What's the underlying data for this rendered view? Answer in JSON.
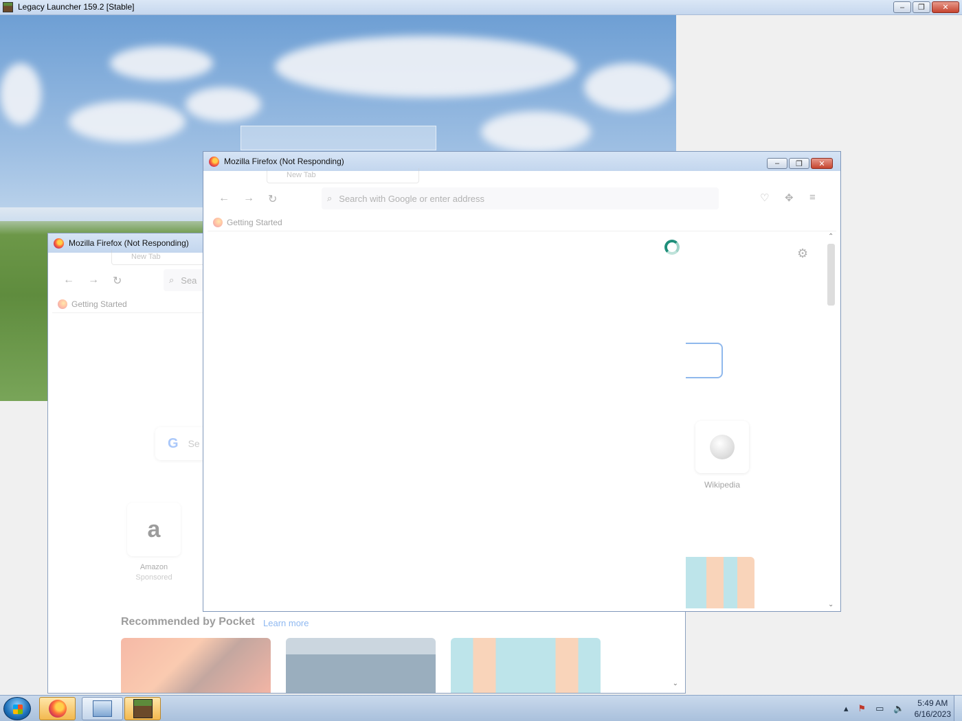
{
  "launcher": {
    "title": "Legacy Launcher 159.2 [Stable]",
    "buttons": {
      "minimize": "–",
      "restore": "❐",
      "close": "✕"
    }
  },
  "firefox_back": {
    "title": "Mozilla Firefox (Not Responding)",
    "tab_label": "New Tab",
    "url_placeholder": "Sea",
    "bookmark": "Getting Started",
    "search_placeholder": "Se",
    "tiles": [
      {
        "name": "Amazon",
        "sub": "Sponsored",
        "glyph": "a"
      }
    ],
    "pocket": {
      "heading": "Recommended by Pocket",
      "link": "Learn more"
    }
  },
  "firefox_front": {
    "title": "Mozilla Firefox (Not Responding)",
    "tab_label": "New Tab",
    "url_placeholder": "Search with Google or enter address",
    "bookmark": "Getting Started",
    "buttons": {
      "minimize": "–",
      "restore": "❐",
      "close": "✕"
    },
    "tiles": [
      {
        "name": "Wikipedia"
      }
    ]
  },
  "taskbar": {
    "time": "5:49 AM",
    "date": "6/16/2023",
    "tray_icons": [
      "show-hidden-icons",
      "action-center-flag",
      "network",
      "volume-muted"
    ]
  }
}
